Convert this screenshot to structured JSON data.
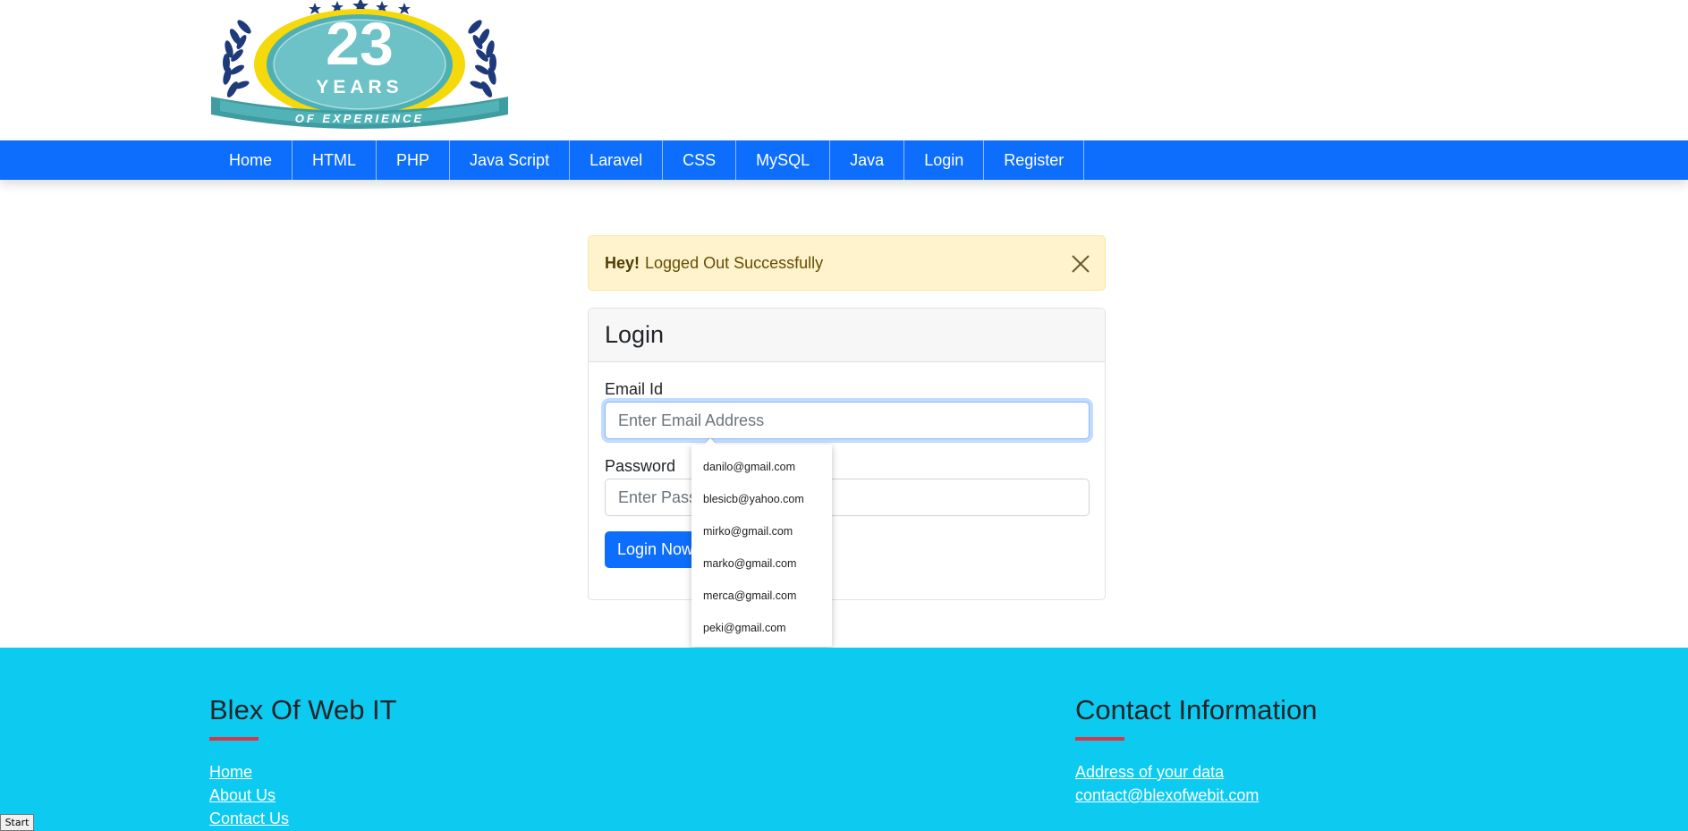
{
  "logo": {
    "number": "23",
    "line1": "YEARS",
    "line2": "OF EXPERIENCE"
  },
  "nav": {
    "items": [
      {
        "label": "Home"
      },
      {
        "label": "HTML"
      },
      {
        "label": "PHP"
      },
      {
        "label": "Java Script"
      },
      {
        "label": "Laravel"
      },
      {
        "label": "CSS"
      },
      {
        "label": "MySQL"
      },
      {
        "label": "Java"
      },
      {
        "label": "Login"
      },
      {
        "label": "Register"
      }
    ]
  },
  "alert": {
    "strong": "Hey!",
    "message": "Logged Out Successfully",
    "close_icon": "close-icon"
  },
  "login": {
    "title": "Login",
    "email_label": "Email Id",
    "email_placeholder": "Enter Email Address",
    "email_value": "",
    "password_label": "Password",
    "password_placeholder": "Enter Password",
    "password_value": "",
    "submit_label": "Login Now"
  },
  "autocomplete": {
    "suggestions": [
      "danilo@gmail.com",
      "blesicb@yahoo.com",
      "mirko@gmail.com",
      "marko@gmail.com",
      "merca@gmail.com",
      "peki@gmail.com"
    ]
  },
  "footer": {
    "left": {
      "title": "Blex Of Web IT",
      "links": [
        "Home",
        "About Us",
        "Contact Us"
      ]
    },
    "right": {
      "title": "Contact Information",
      "links": [
        "Address of your data",
        "contact@blexofwebit.com"
      ]
    }
  },
  "taskbar": {
    "start_label": "Start"
  },
  "colors": {
    "navbar": "#0d6efd",
    "footer": "#0dcaf0",
    "alert_bg": "#fff3cd",
    "accent_bar": "#dc3545"
  }
}
